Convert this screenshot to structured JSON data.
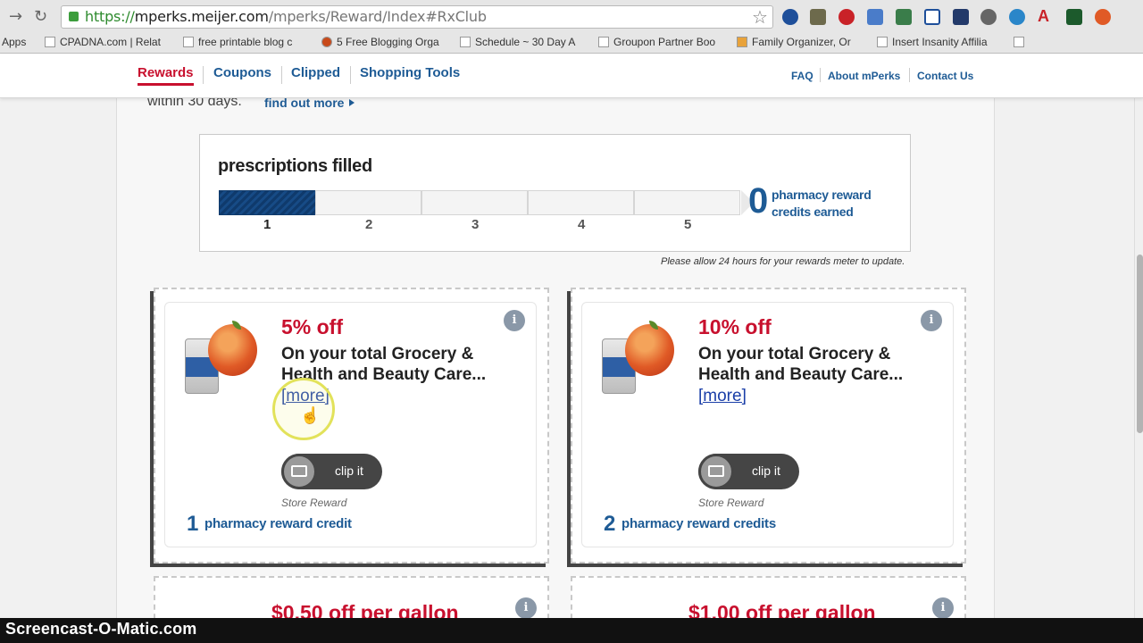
{
  "browser": {
    "url_scheme": "https://",
    "url_host": "mperks.meijer.com",
    "url_path": "/mperks/Reward/Index#RxClub",
    "bookmarks": [
      "Apps",
      "CPADNA.com | Relat",
      "free printable blog c",
      "5 Free Blogging Orga",
      "Schedule ~ 30 Day A",
      "Groupon Partner Boo",
      "Family Organizer, Or",
      "Insert Insanity Affilia"
    ]
  },
  "nav": {
    "tabs": [
      "Rewards",
      "Coupons",
      "Clipped",
      "Shopping Tools"
    ],
    "active_tab": "Rewards",
    "links": [
      "FAQ",
      "About mPerks",
      "Contact Us"
    ]
  },
  "intro": {
    "text": "within 30 days.",
    "find_out_more": "find out more"
  },
  "meter": {
    "title": "prescriptions filled",
    "steps": [
      "1",
      "2",
      "3",
      "4",
      "5"
    ],
    "filled_steps": 1,
    "credits_earned": "0",
    "credits_label_1": "pharmacy reward",
    "credits_label_2": "credits earned",
    "note": "Please allow 24 hours for your rewards meter to update."
  },
  "coupons": [
    {
      "title": "5% off",
      "desc": "On your total Grocery & Health and Beauty Care...",
      "more": "[more]",
      "clip": "clip it",
      "store": "Store Reward",
      "credit_num": "1",
      "credit_text": "pharmacy reward credit",
      "info": "i"
    },
    {
      "title": "10% off",
      "desc": "On your total Grocery & Health and Beauty Care...",
      "more": "[more]",
      "clip": "clip it",
      "store": "Store Reward",
      "credit_num": "2",
      "credit_text": "pharmacy reward credits",
      "info": "i"
    },
    {
      "title": "$0.50 off per gallon",
      "info": "i"
    },
    {
      "title": "$1.00 off per gallon",
      "info": "i"
    }
  ],
  "watermark": "Screencast-O-Matic.com",
  "colors": {
    "brand_red": "#c8102e",
    "brand_blue": "#1e5b95",
    "meter_fill": "#0f3a6c"
  }
}
